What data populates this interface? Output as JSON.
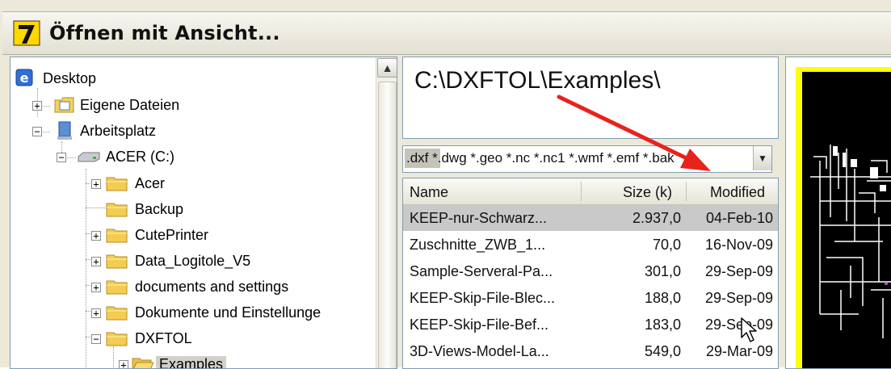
{
  "title": {
    "text": "Öffnen mit Ansicht..."
  },
  "tree": {
    "items": [
      {
        "label": "Desktop"
      },
      {
        "label": "Eigene Dateien"
      },
      {
        "label": "Arbeitsplatz"
      },
      {
        "label": "ACER (C:)"
      },
      {
        "label": "Acer"
      },
      {
        "label": "Backup"
      },
      {
        "label": "CutePrinter"
      },
      {
        "label": "Data_Logitole_V5"
      },
      {
        "label": "documents and settings"
      },
      {
        "label": "Dokumente und Einstellunge"
      },
      {
        "label": "DXFTOL"
      },
      {
        "label": "Examples"
      }
    ]
  },
  "path": {
    "text": "C:\\DXFTOL\\Examples\\"
  },
  "filter": {
    "text": ".dxf *.dwg *.geo *.nc *.nc1 *.wmf *.emf *.bak"
  },
  "list": {
    "headers": {
      "name": "Name",
      "size": "Size (k)",
      "modified": "Modified"
    },
    "rows": [
      {
        "name": "KEEP-nur-Schwarz...",
        "size": "2.937,0",
        "modified": "04-Feb-10"
      },
      {
        "name": "Zuschnitte_ZWB_1...",
        "size": "70,0",
        "modified": "16-Nov-09"
      },
      {
        "name": "Sample-Serveral-Pa...",
        "size": "301,0",
        "modified": "29-Sep-09"
      },
      {
        "name": "KEEP-Skip-File-Blec...",
        "size": "188,0",
        "modified": "29-Sep-09"
      },
      {
        "name": "KEEP-Skip-File-Bef...",
        "size": "183,0",
        "modified": "29-Sep-09"
      },
      {
        "name": "3D-Views-Model-La...",
        "size": "549,0",
        "modified": "29-Mar-09"
      }
    ]
  },
  "colors": {
    "arrow": "#e8231c",
    "preview_border": "#ffff00"
  }
}
